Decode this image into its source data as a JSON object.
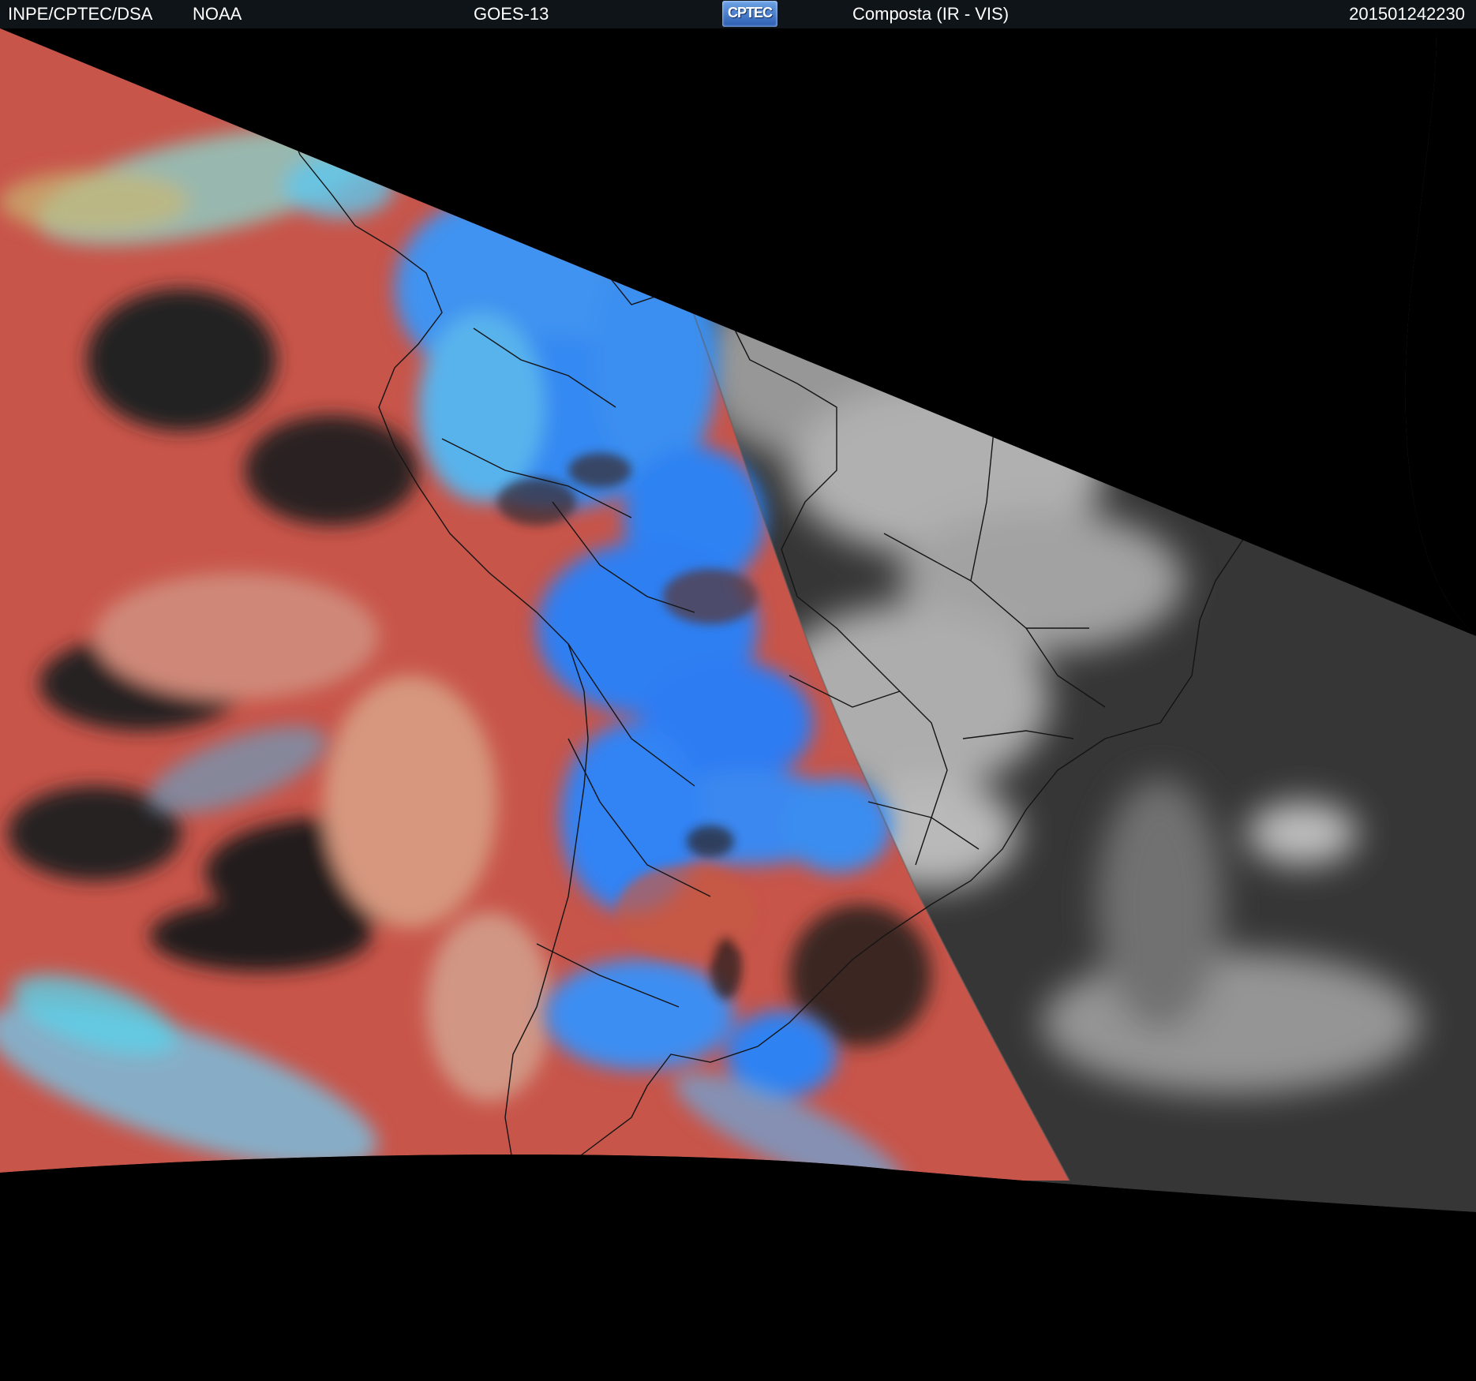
{
  "header": {
    "institution": "INPE/CPTEC/DSA",
    "agency": "NOAA",
    "satellite": "GOES-13",
    "logo_text": "CPTEC",
    "product": "Composta (IR - VIS)",
    "timestamp": "201501242230"
  },
  "palette": {
    "ocean_ir_red": "#c8554a",
    "cold_cloud_blue": "#2c7cf0",
    "cyan_cloud": "#55d4e8",
    "clear_dark": "#1e1e1e",
    "vis_night_grey": "#3a3a3a",
    "vis_cloud_white": "#d8d8d8",
    "space_black": "#000000",
    "header_bg": "#0f1419"
  },
  "icons": {
    "logo": "cptec-logo"
  }
}
